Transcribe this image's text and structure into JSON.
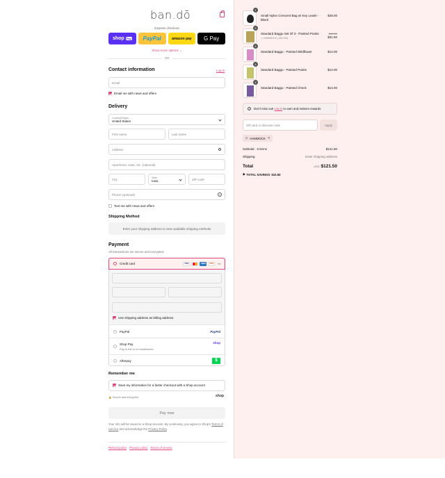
{
  "brand": {
    "logo": "ban.dō"
  },
  "express": {
    "heading": "Express checkout",
    "buttons": [
      "shop",
      "PayPal",
      "amazon pay",
      "G Pay"
    ],
    "shop_tag": "Pay",
    "more": "Show more options ⌄",
    "or": "OR"
  },
  "contact": {
    "title": "Contact information",
    "login": "Log in",
    "email_placeholder": "Email",
    "email_news": "Email me with news and offers"
  },
  "delivery": {
    "title": "Delivery",
    "country_label": "Country/Region",
    "country_value": "United States",
    "first_name": "First name",
    "last_name": "Last name",
    "address": "Address",
    "apartment": "Apartment, suite, etc. (optional)",
    "city": "City",
    "state_label": "State",
    "state_value": "Iowa",
    "zip": "ZIP code",
    "phone": "Phone (optional)",
    "text_news": "Text me with news and offers"
  },
  "shipping_method": {
    "title": "Shipping Method",
    "notice": "Enter your shipping address to view available shipping methods"
  },
  "payment": {
    "title": "Payment",
    "subtitle": "All transactions are secure and encrypted.",
    "credit_card": "Credit card",
    "cards": [
      "VISA",
      "MC",
      "AMEX",
      "DISC"
    ],
    "more_cards": "+4",
    "billing_same": "Use shipping address as billing address",
    "paypal": "PayPal",
    "paypal_badge": "PayPal",
    "shop_pay": "Shop Pay",
    "shop_pay_sub": "Pay in full or in installments",
    "shop_badge": "shop",
    "afterpay": "Afterpay",
    "afterpay_badge": "$"
  },
  "remember": {
    "title": "Remember me",
    "save_info": "Save my information for a faster checkout with a Shop account",
    "secure": "Secure and encrypted",
    "shop_badge": "shop"
  },
  "pay_now": "Pay now",
  "legal": {
    "line1": "Your info will be saved to a Shop account. By continuing, you agree to Shop's",
    "terms": "Terms of Service",
    "mid": "and acknowledge the",
    "privacy": "Privacy Policy",
    "end": "."
  },
  "footer_links": [
    "Refund policy",
    "Privacy policy",
    "Terms of service"
  ],
  "cart": {
    "items": [
      {
        "qty": "1",
        "name": "Small Nylon Crescent Bag w/ Key Leash - Black",
        "price": "$48.00",
        "thumb_color": "#222222"
      },
      {
        "qty": "5",
        "name": "Standard Baggu Set Of 3 - Painted Prairie",
        "discount_code": "HAMMOCK (-$10.50)",
        "original_price": "$42.00",
        "price": "$31.50",
        "thumb_color": "#b9a35a"
      },
      {
        "qty": "4",
        "name": "Standard Baggu - Painted Wildflower",
        "price": "$14.00",
        "thumb_color": "#d88cc8"
      },
      {
        "qty": "4",
        "name": "Standard Baggu - Painted Prairie",
        "price": "$14.00",
        "thumb_color": "#c6c46a"
      },
      {
        "qty": "4",
        "name": "Standard Baggu - Painted Check",
        "price": "$14.00",
        "thumb_color": "#7a5a9e"
      }
    ],
    "rewards_prefix": "Don't miss out!",
    "rewards_link": "Log in",
    "rewards_suffix": "to earn and redeem rewards",
    "gift_placeholder": "Gift card or discount code",
    "apply": "Apply",
    "discount_chip": "HAMMOCK",
    "subtotal_label": "Subtotal · 5 items",
    "subtotal_value": "$121.50",
    "shipping_label": "Shipping",
    "shipping_value": "Enter shipping address",
    "total_label": "Total",
    "currency": "USD",
    "total_value": "$121.50",
    "savings_label": "TOTAL SAVINGS",
    "savings_value": "$10.50"
  },
  "colors": {
    "accent": "#e0457b",
    "summary_bg": "#fdf0ef",
    "shop_purple": "#5a31f4"
  }
}
